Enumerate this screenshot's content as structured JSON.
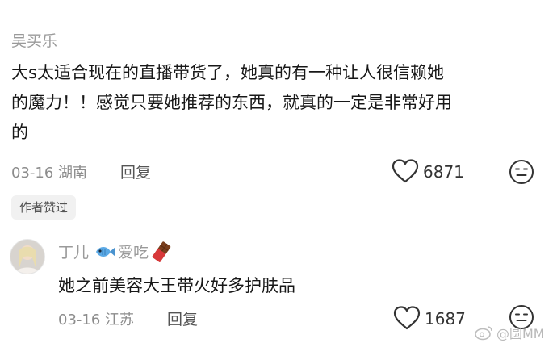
{
  "comment1": {
    "username": "吴买乐",
    "lines": [
      "大s太适合现在的直播带货了，她真的有一种让人很信赖她",
      "的魔力！！感觉只要她推荐的东西，就真的一定是非常好用",
      "的"
    ],
    "date": "03-16",
    "location": "湖南",
    "reply_label": "回复",
    "like_count": "6871"
  },
  "author_liked_badge": "作者赞过",
  "comment2": {
    "username_prefix": "丁儿",
    "username_suffix": "爱吃",
    "text": "她之前美容大王带火好多护肤品",
    "date": "03-16",
    "location": "江苏",
    "reply_label": "回复",
    "like_count": "1687"
  },
  "watermark": "@圆MM",
  "icons": {
    "like": "heart-outline-icon",
    "dislike": "neutral-face-icon",
    "fish": "fish-emoji-icon",
    "chocolate": "chocolate-emoji-icon",
    "weibo": "weibo-logo-icon"
  }
}
